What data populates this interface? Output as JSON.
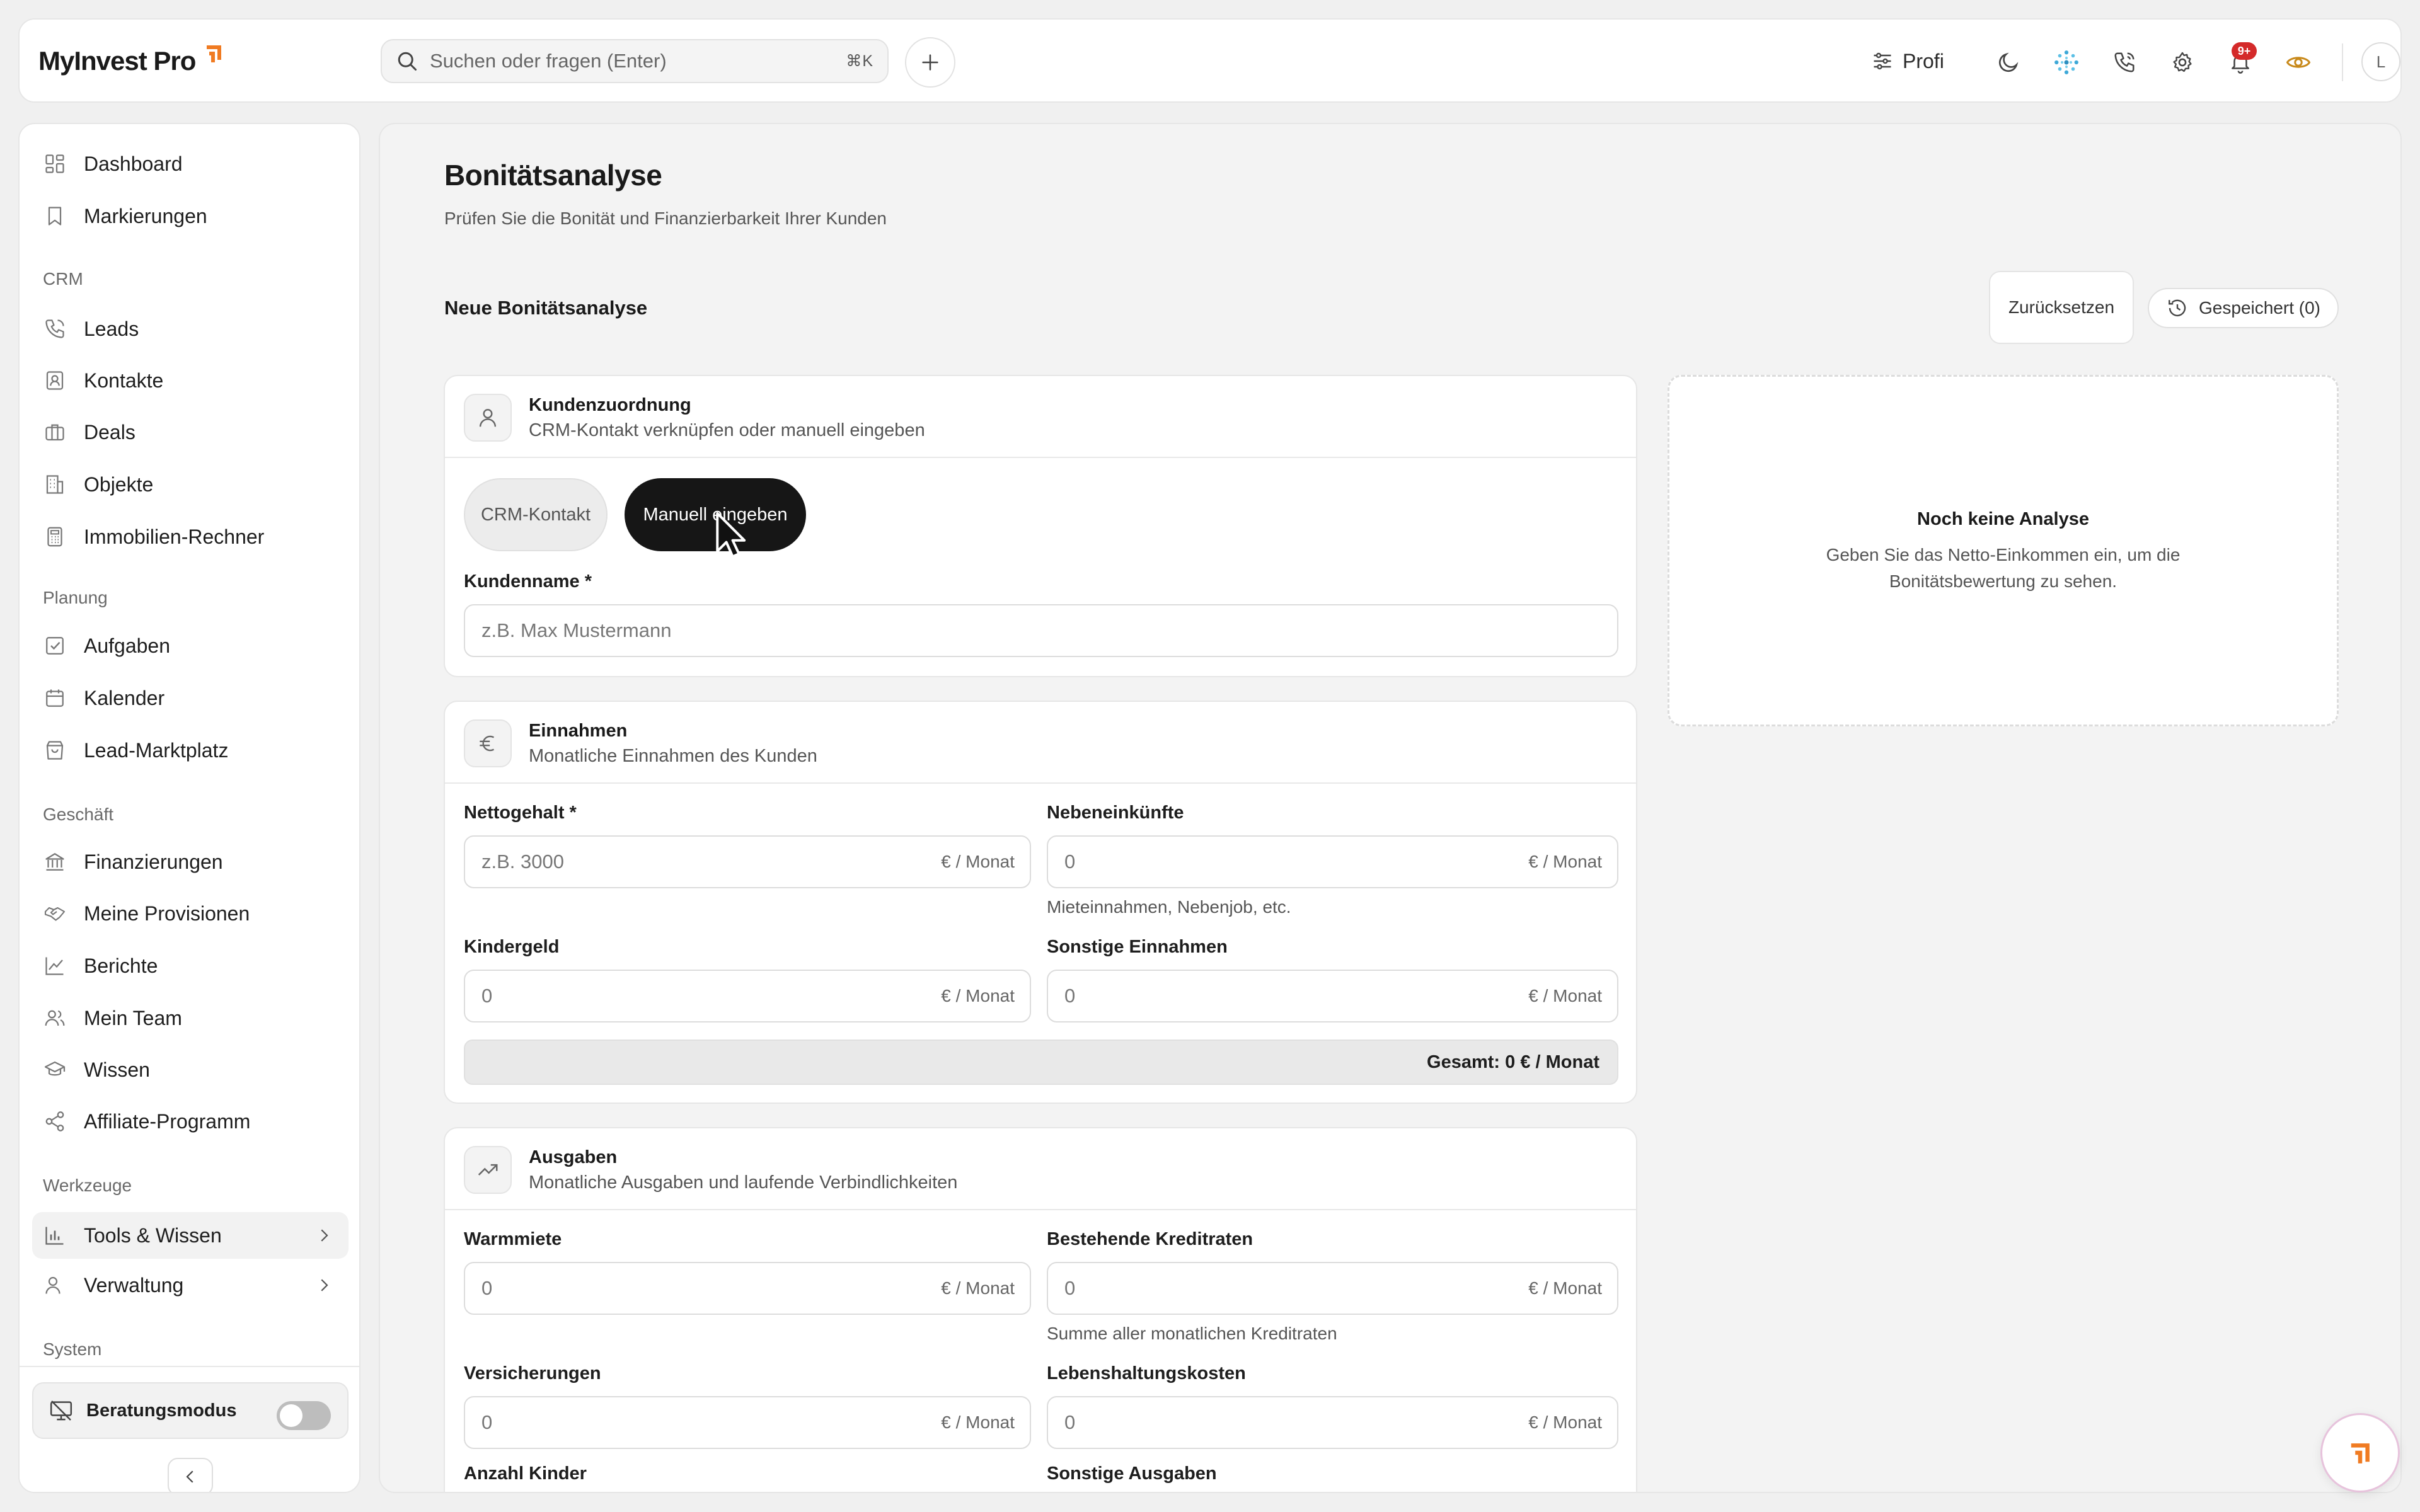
{
  "app": {
    "name": "MyInvest Pro"
  },
  "search": {
    "placeholder": "Suchen oder fragen (Enter)",
    "shortcut": "⌘K"
  },
  "topbar": {
    "plan_label": "Profi",
    "notification_count": "9+",
    "avatar_initial": "L"
  },
  "sidebar": {
    "top_items": [
      {
        "label": "Dashboard",
        "icon": "dashboard-icon"
      },
      {
        "label": "Markierungen",
        "icon": "bookmark-icon"
      }
    ],
    "sections": {
      "crm": "CRM",
      "planung": "Planung",
      "geschaeft": "Geschäft",
      "werkzeuge": "Werkzeuge",
      "system": "System"
    },
    "crm_items": [
      {
        "label": "Leads",
        "icon": "phone-icon"
      },
      {
        "label": "Kontakte",
        "icon": "contact-icon"
      },
      {
        "label": "Deals",
        "icon": "briefcase-icon"
      },
      {
        "label": "Objekte",
        "icon": "building-icon"
      },
      {
        "label": "Immobilien-Rechner",
        "icon": "calculator-icon"
      }
    ],
    "planung_items": [
      {
        "label": "Aufgaben",
        "icon": "checkbox-icon"
      },
      {
        "label": "Kalender",
        "icon": "calendar-icon"
      },
      {
        "label": "Lead-Marktplatz",
        "icon": "shopping-bag-icon"
      }
    ],
    "geschaeft_items": [
      {
        "label": "Finanzierungen",
        "icon": "bank-icon"
      },
      {
        "label": "Meine Provisionen",
        "icon": "handshake-icon"
      },
      {
        "label": "Berichte",
        "icon": "chart-line-icon"
      },
      {
        "label": "Mein Team",
        "icon": "users-icon"
      },
      {
        "label": "Wissen",
        "icon": "graduation-cap-icon"
      },
      {
        "label": "Affiliate-Programm",
        "icon": "share-icon"
      }
    ],
    "werkzeuge_items": [
      {
        "label": "Tools & Wissen",
        "icon": "bar-chart-icon",
        "active": true
      },
      {
        "label": "Verwaltung",
        "icon": "user-cog-icon"
      }
    ],
    "mode": {
      "label": "Beratungsmodus",
      "enabled": false
    }
  },
  "page": {
    "title": "Bonitätsanalyse",
    "subtitle": "Prüfen Sie die Bonität und Finanzierbarkeit Ihrer Kunden",
    "section_title": "Neue Bonitätsanalyse",
    "reset_label": "Zurücksetzen",
    "saved_label": "Gespeichert (0)"
  },
  "customer": {
    "title": "Kundenzuordnung",
    "subtitle": "CRM-Kontakt verknüpfen oder manuell eingeben",
    "options": [
      "CRM-Kontakt",
      "Manuell eingeben"
    ],
    "selected": "Manuell eingeben",
    "name_label": "Kundenname *",
    "name_placeholder": "z.B. Max Mustermann"
  },
  "income": {
    "title": "Einnahmen",
    "subtitle": "Monatliche Einnahmen des Kunden",
    "net_label": "Nettogehalt *",
    "net_placeholder": "z.B. 3000",
    "side_label": "Nebeneinkünfte",
    "side_value": "0",
    "side_hint": "Mieteinnahmen, Nebenjob, etc.",
    "child_label": "Kindergeld",
    "child_value": "0",
    "other_label": "Sonstige Einnahmen",
    "other_value": "0",
    "unit": "€ / Monat",
    "total": "Gesamt: 0 € / Monat"
  },
  "expenses": {
    "title": "Ausgaben",
    "subtitle": "Monatliche Ausgaben und laufende Verbindlichkeiten",
    "rent_label": "Warmmiete",
    "rent_value": "0",
    "credit_label": "Bestehende Kreditraten",
    "credit_value": "0",
    "credit_hint": "Summe aller monatlichen Kreditraten",
    "insurance_label": "Versicherungen",
    "insurance_value": "0",
    "living_label": "Lebenshaltungskosten",
    "living_value": "0",
    "children_label": "Anzahl Kinder",
    "other_label": "Sonstige Ausgaben",
    "unit": "€ / Monat"
  },
  "result": {
    "empty_title": "Noch keine Analyse",
    "empty_text": "Geben Sie das Netto-Einkommen ein, um die Bonitätsbewertung zu sehen."
  },
  "colors": {
    "accent": "#f07b22",
    "dark": "#161616",
    "eye": "#c8891a",
    "bell_badge": "#d42a2a"
  }
}
